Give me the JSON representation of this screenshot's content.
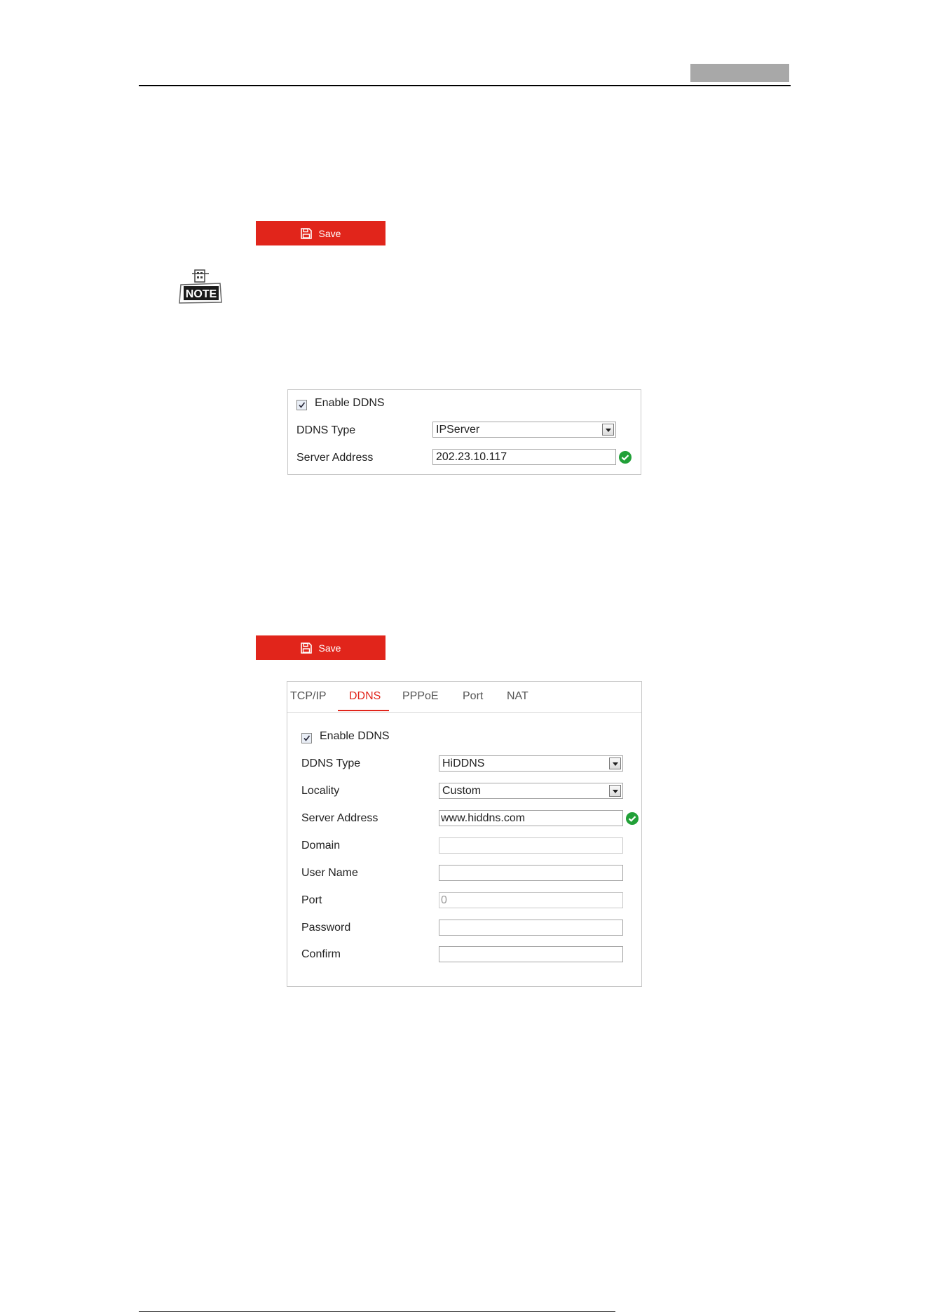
{
  "save_label": "Save",
  "note_label": "NOTE",
  "accent_color": "#e1251b",
  "panel1": {
    "enable_label": "Enable DDNS",
    "enable_checked": true,
    "ddns_type_label": "DDNS Type",
    "ddns_type_value": "IPServer",
    "server_address_label": "Server Address",
    "server_address_value": "202.23.10.117"
  },
  "panel2": {
    "tabs": [
      "TCP/IP",
      "DDNS",
      "PPPoE",
      "Port",
      "NAT"
    ],
    "active_tab": "DDNS",
    "enable_label": "Enable DDNS",
    "enable_checked": true,
    "ddns_type_label": "DDNS Type",
    "ddns_type_value": "HiDDNS",
    "locality_label": "Locality",
    "locality_value": "Custom",
    "server_address_label": "Server Address",
    "server_address_value": "www.hiddns.com",
    "domain_label": "Domain",
    "domain_value": "",
    "user_name_label": "User Name",
    "user_name_value": "",
    "port_label": "Port",
    "port_value": "0",
    "password_label": "Password",
    "password_value": "",
    "confirm_label": "Confirm",
    "confirm_value": ""
  }
}
